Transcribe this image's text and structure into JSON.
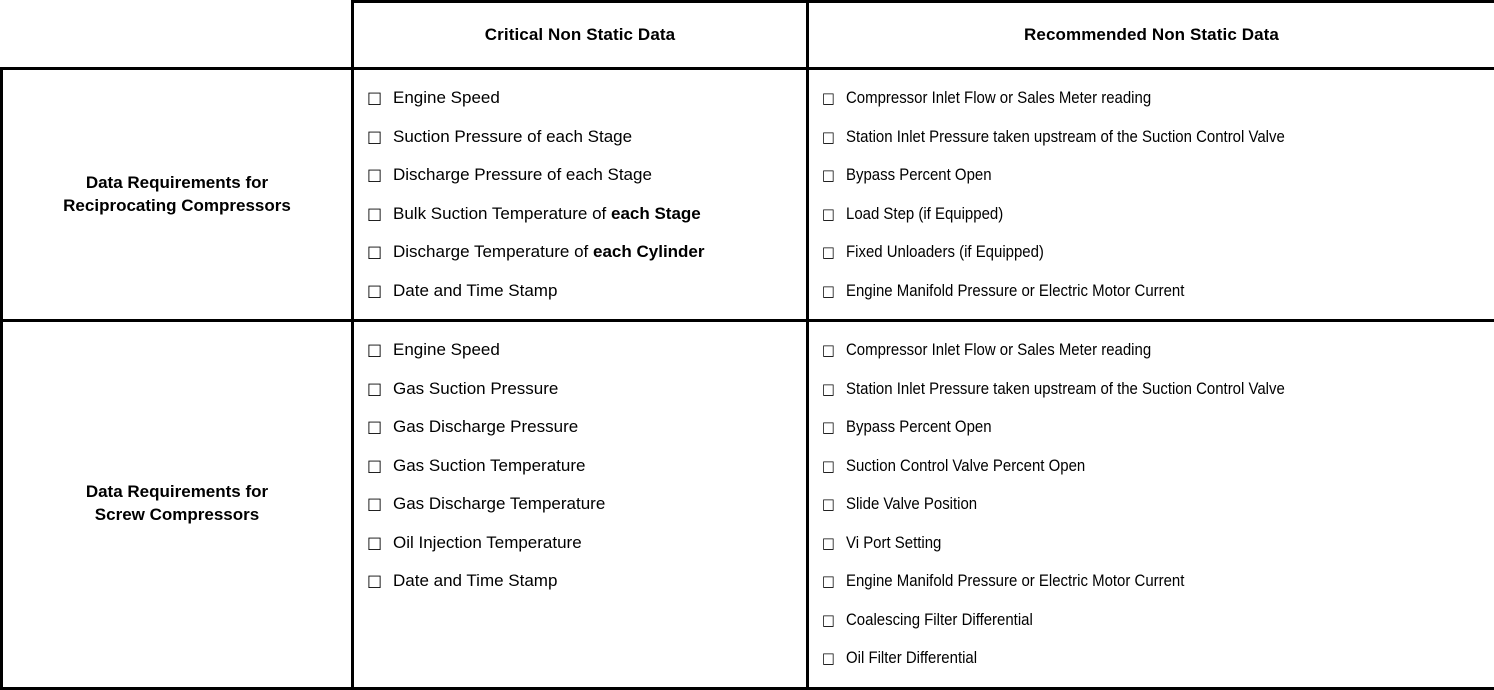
{
  "document": {
    "title": "Compressor Data Requirements Table"
  },
  "table": {
    "columns": [
      {
        "key": "label",
        "header": ""
      },
      {
        "key": "critical",
        "header": "Critical Non Static Data"
      },
      {
        "key": "recommended",
        "header": "Recommended Non Static Data"
      }
    ],
    "checkbox_glyph": "□",
    "rows": [
      {
        "label_lines": [
          "Data Requirements for",
          "Reciprocating Compressors"
        ],
        "critical": [
          {
            "text": "Engine Speed",
            "bold_tail": ""
          },
          {
            "text": "Suction Pressure of each Stage",
            "bold_tail": ""
          },
          {
            "text": "Discharge Pressure of each Stage",
            "bold_tail": ""
          },
          {
            "text": "Bulk Suction Temperature of ",
            "bold_tail": "each Stage"
          },
          {
            "text": "Discharge Temperature of ",
            "bold_tail": "each Cylinder"
          },
          {
            "text": "Date and Time Stamp",
            "bold_tail": ""
          }
        ],
        "recommended": [
          {
            "text": "Compressor Inlet Flow or Sales Meter reading",
            "bold_tail": ""
          },
          {
            "text": "Station Inlet Pressure taken upstream of the Suction Control Valve",
            "bold_tail": ""
          },
          {
            "text": "Bypass Percent Open",
            "bold_tail": ""
          },
          {
            "text": "Load Step (if Equipped)",
            "bold_tail": ""
          },
          {
            "text": "Fixed Unloaders (if Equipped)",
            "bold_tail": ""
          },
          {
            "text": "Engine Manifold Pressure or  Electric Motor Current",
            "bold_tail": ""
          }
        ]
      },
      {
        "label_lines": [
          "Data Requirements for",
          "Screw Compressors"
        ],
        "critical": [
          {
            "text": "Engine Speed",
            "bold_tail": ""
          },
          {
            "text": "Gas Suction Pressure",
            "bold_tail": ""
          },
          {
            "text": "Gas Discharge Pressure",
            "bold_tail": ""
          },
          {
            "text": "Gas Suction Temperature",
            "bold_tail": ""
          },
          {
            "text": "Gas Discharge Temperature",
            "bold_tail": ""
          },
          {
            "text": "Oil Injection Temperature",
            "bold_tail": ""
          },
          {
            "text": "Date and Time Stamp",
            "bold_tail": ""
          }
        ],
        "recommended": [
          {
            "text": "Compressor Inlet Flow or Sales Meter reading",
            "bold_tail": ""
          },
          {
            "text": "Station Inlet Pressure taken upstream of the Suction Control Valve",
            "bold_tail": ""
          },
          {
            "text": "Bypass Percent Open",
            "bold_tail": ""
          },
          {
            "text": "Suction Control Valve Percent Open",
            "bold_tail": ""
          },
          {
            "text": "Slide Valve Position",
            "bold_tail": ""
          },
          {
            "text": "Vi Port Setting",
            "bold_tail": ""
          },
          {
            "text": "Engine Manifold Pressure or  Electric Motor Current",
            "bold_tail": ""
          },
          {
            "text": "Coalescing Filter Differential",
            "bold_tail": ""
          },
          {
            "text": "Oil Filter Differential",
            "bold_tail": ""
          }
        ]
      }
    ]
  },
  "colors": {
    "border": "#000000",
    "text": "#000000",
    "background": "#ffffff"
  }
}
